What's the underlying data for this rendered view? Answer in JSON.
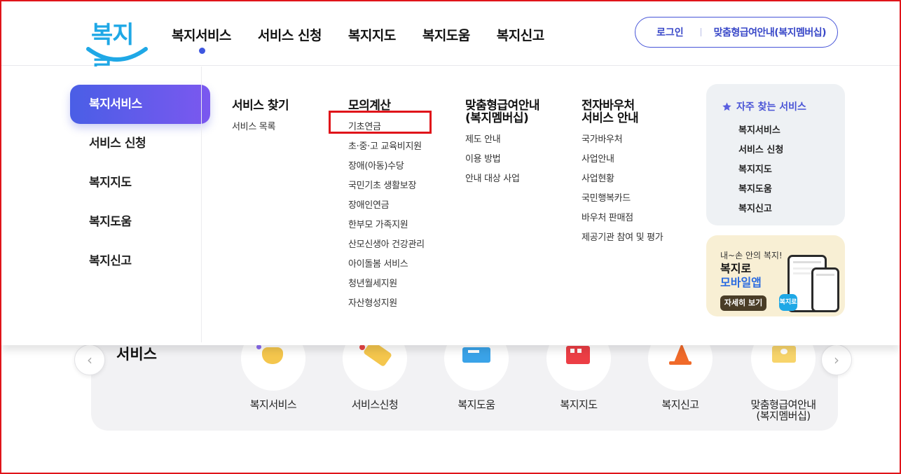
{
  "header": {
    "logo_text": "복지로",
    "gnb": [
      "복지서비스",
      "서비스 신청",
      "복지지도",
      "복지도움",
      "복지신고"
    ],
    "login": "로그인",
    "custom_guide": "맞춤형급여안내(복지멤버십)"
  },
  "sidebar": {
    "items": [
      {
        "label": "복지서비스",
        "active": true
      },
      {
        "label": "서비스 신청",
        "active": false
      },
      {
        "label": "복지지도",
        "active": false
      },
      {
        "label": "복지도움",
        "active": false
      },
      {
        "label": "복지신고",
        "active": false
      }
    ]
  },
  "columns": [
    {
      "title": "서비스 찾기",
      "links": [
        "서비스 목록"
      ]
    },
    {
      "title": "모의계산",
      "links": [
        "기초연금",
        "초·중·고 교육비지원",
        "장애(아동)수당",
        "국민기초 생활보장",
        "장애인연금",
        "한부모 가족지원",
        "산모신생아 건강관리",
        "아이돌봄 서비스",
        "청년월세지원",
        "자산형성지원"
      ]
    },
    {
      "title_line1": "맞춤형급여안내",
      "title_line2": "(복지멤버십)",
      "links": [
        "제도 안내",
        "이용 방법",
        "안내 대상 사업"
      ]
    },
    {
      "title_line1": "전자바우처",
      "title_line2": "서비스 안내",
      "links": [
        "국가바우처",
        "사업안내",
        "사업현황",
        "국민행복카드",
        "바우처 판매점",
        "제공기관 참여 및 평가"
      ]
    }
  ],
  "favorites": {
    "title": "자주 찾는 서비스",
    "icon": "star-icon",
    "links": [
      "복지서비스",
      "서비스 신청",
      "복지지도",
      "복지도움",
      "복지신고"
    ]
  },
  "app_banner": {
    "subtitle": "내~손 안의 복지!",
    "title_line1": "복지로",
    "title_line2": "모바일앱",
    "button": "자세히 보기"
  },
  "background": {
    "heading": "서비스",
    "services": [
      "복지서비스",
      "서비스신청",
      "복지도움",
      "복지지도",
      "복지신고"
    ],
    "last_service_line1": "맞춤형급여안내",
    "last_service_line2": "(복지멤버십)"
  },
  "colors": {
    "accent": "#4a5ee6",
    "accent_purple": "#7b58ef",
    "highlight": "#e0141a",
    "logo": "#1fa8e6"
  }
}
